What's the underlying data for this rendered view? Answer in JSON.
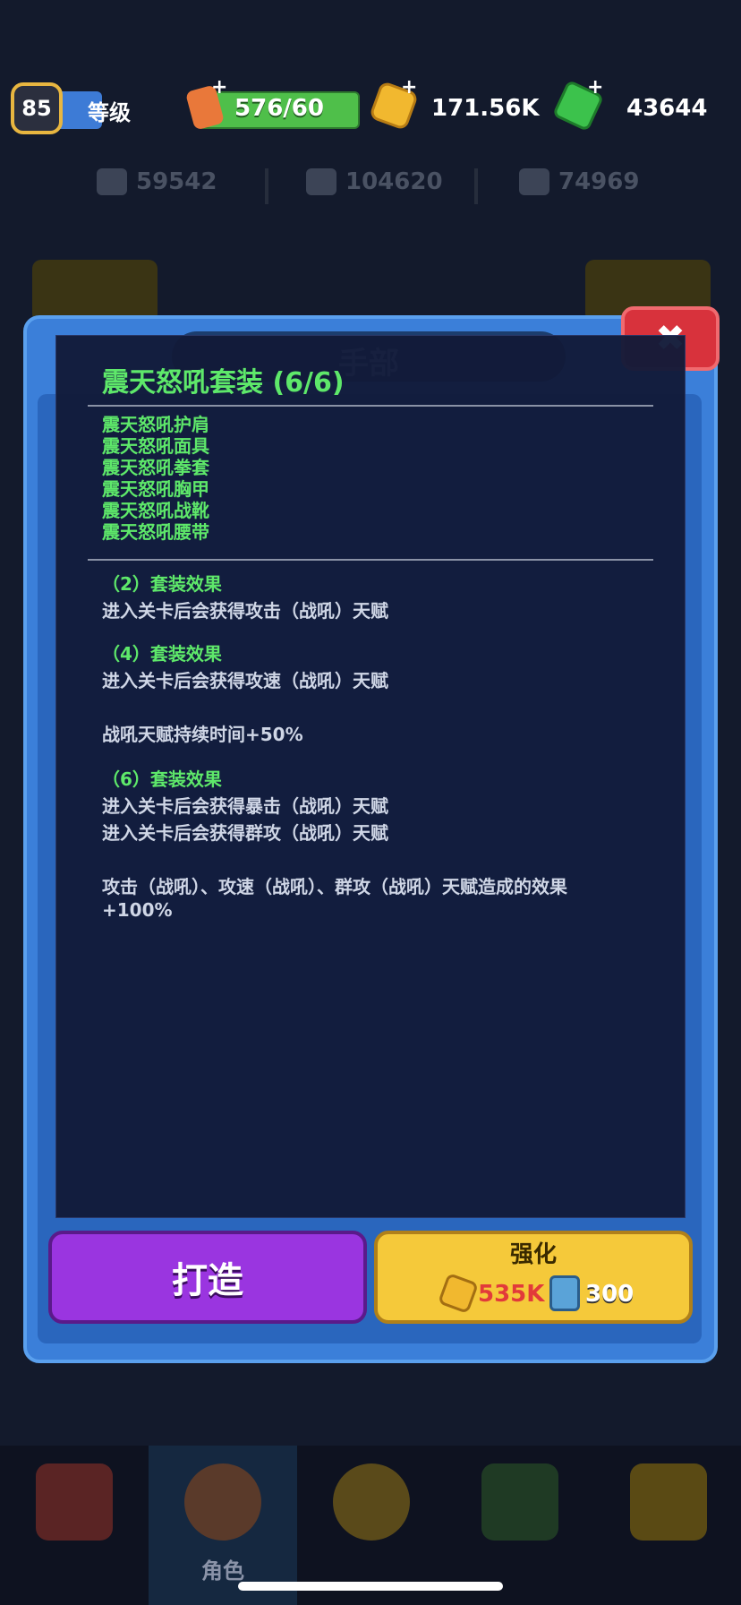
{
  "status_bar": {
    "level": "85",
    "level_label": "等级",
    "energy": "576/60",
    "coins": "171.56K",
    "gems": "43644"
  },
  "stats": {
    "attack": "59542",
    "health": "104620",
    "defense": "74969"
  },
  "modal": {
    "tab_title": "手部",
    "close_label": "✖"
  },
  "set_tooltip": {
    "title": "震天怒吼套装 (6/6)",
    "pieces": [
      "震天怒吼护肩",
      "震天怒吼面具",
      "震天怒吼拳套",
      "震天怒吼胸甲",
      "震天怒吼战靴",
      "震天怒吼腰带"
    ],
    "bonus2_head": "（2）套装效果",
    "bonus2_line1": "进入关卡后会获得攻击（战吼）天赋",
    "bonus4_head": "（4）套装效果",
    "bonus4_line1": "进入关卡后会获得攻速（战吼）天赋",
    "bonus4_line2": "战吼天赋持续时间+50%",
    "bonus6_head": "（6）套装效果",
    "bonus6_line1": "进入关卡后会获得暴击（战吼）天赋",
    "bonus6_line2": "进入关卡后会获得群攻（战吼）天赋",
    "bonus6_line3": "攻击（战吼）、攻速（战吼）、群攻（战吼）天赋造成的效果",
    "bonus6_line4": "+100%"
  },
  "buttons": {
    "forge": "打造",
    "enhance": "强化",
    "enhance_coin_cost": "535K",
    "enhance_scroll_cost": "300"
  },
  "nav": {
    "character_label": "角色"
  },
  "colors": {
    "accent_green": "#5ee86a",
    "modal_blue": "#3b7fd9",
    "forge_purple": "#9a35e0",
    "enhance_yellow": "#f5c93a"
  }
}
